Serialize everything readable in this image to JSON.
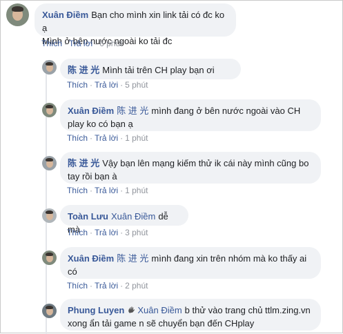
{
  "colors": {
    "name": "#385898",
    "bubble": "#f0f2f5",
    "meta": "#90949c"
  },
  "comments": [
    {
      "author": "Xuân Điềm",
      "mention": "",
      "text": "Bạn cho mình xin link tải có đc ko ạ",
      "text2": "Mình ở bên nước ngoài ko tải đc",
      "like": "Thích",
      "reply": "Trả lời",
      "time": "6 phút"
    },
    {
      "author": "陈 进 光",
      "mention": "",
      "text": "Mình tải trên CH play bạn ơi",
      "like": "Thích",
      "reply": "Trả lời",
      "time": "5 phút"
    },
    {
      "author": "Xuân Điềm",
      "mention": "陈 进 光",
      "text": "mình đang ở bên nước ngoài vào CH",
      "text2": "play ko có bạn ạ",
      "like": "Thích",
      "reply": "Trả lời",
      "time": "1 phút"
    },
    {
      "author": "陈 进 光",
      "mention": "",
      "text": "Vậy bạn lên mạng kiếm thử ik cái này mình cũng bo",
      "text2": "tay rồi bạn à",
      "like": "Thích",
      "reply": "Trả lời",
      "time": "1 phút"
    },
    {
      "author": "Toàn Lưu",
      "mention": "Xuân Điềm",
      "text": "dễ mà",
      "like": "Thích",
      "reply": "Trả lời",
      "time": "3 phút"
    },
    {
      "author": "Xuân Điềm",
      "mention": "陈 进 光",
      "text": "mình đang xin trên nhóm mà ko thấy ai",
      "text2": "có",
      "like": "Thích",
      "reply": "Trả lời",
      "time": "2 phút"
    },
    {
      "author": "Phung Luyen",
      "mention": "Xuân Điềm",
      "text": "b thử vào trang chủ ttlm.zing.vn",
      "text2": "xong ẩn tải game n sẽ chuyển bạn đến CHplay",
      "icon": "waving-hand-icon"
    }
  ]
}
